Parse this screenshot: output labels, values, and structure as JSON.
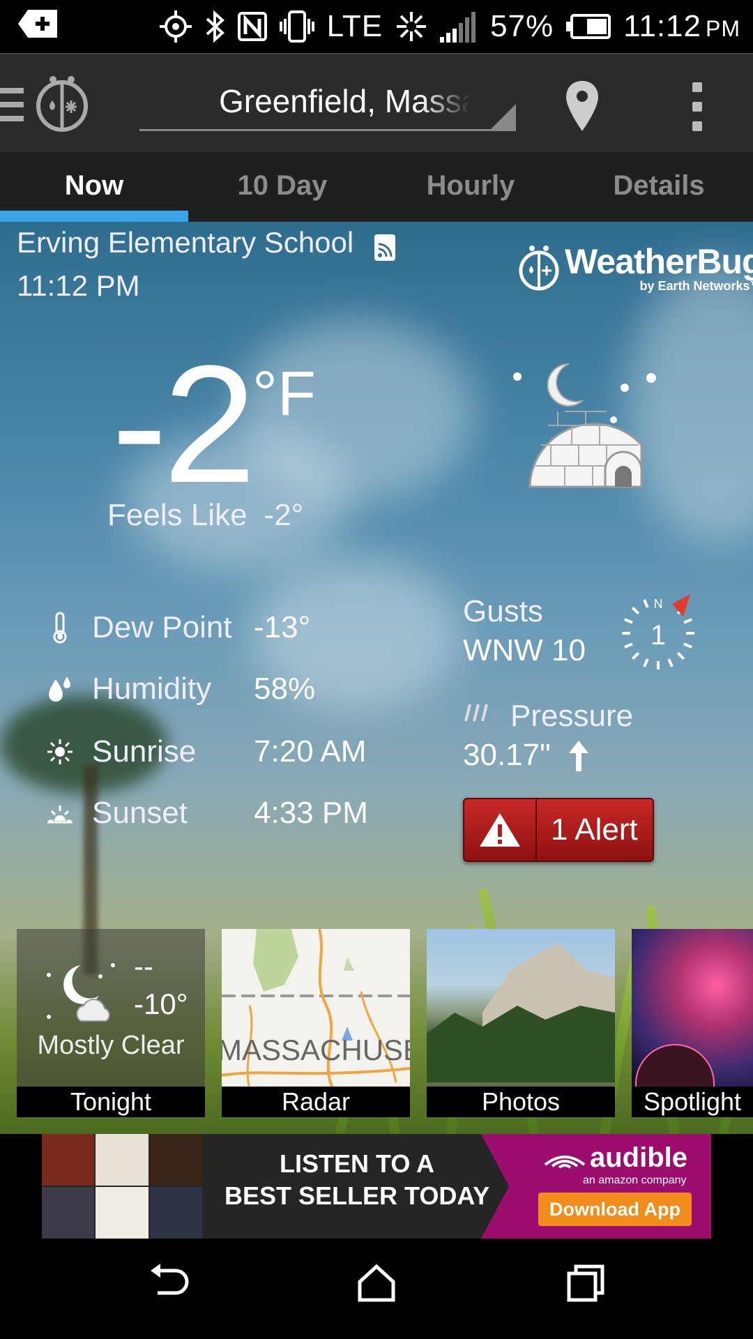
{
  "status_bar": {
    "network": "LTE",
    "battery": "57%",
    "time": "11:12",
    "ampm": "PM"
  },
  "app_bar": {
    "location": "Greenfield, Massachusetts"
  },
  "tabs": [
    {
      "label": "Now",
      "active": true
    },
    {
      "label": "10 Day",
      "active": false
    },
    {
      "label": "Hourly",
      "active": false
    },
    {
      "label": "Details",
      "active": false
    }
  ],
  "current": {
    "station": "Erving Elementary School",
    "time": "11:12 PM",
    "temperature": "-2",
    "unit": "°F",
    "feels_like_label": "Feels Like",
    "feels_like_value": "-2°",
    "condition_icon": "igloo-night-icon"
  },
  "brand": {
    "name": "WeatherBug",
    "sub": "by Earth Networks™"
  },
  "details": [
    {
      "icon": "thermometer-icon",
      "label": "Dew Point",
      "value": "-13°"
    },
    {
      "icon": "humidity-drop-icon",
      "label": "Humidity",
      "value": "58%"
    },
    {
      "icon": "sunrise-icon",
      "label": "Sunrise",
      "value": "7:20 AM"
    },
    {
      "icon": "sunset-icon",
      "label": "Sunset",
      "value": "4:33 PM"
    }
  ],
  "wind": {
    "label": "Gusts",
    "value": "WNW 10",
    "compass_letter": "N",
    "compass_speed": "1"
  },
  "pressure": {
    "label": "Pressure",
    "value": "30.17\"",
    "trend": "rising"
  },
  "alert": {
    "label": "1 Alert"
  },
  "cards": {
    "tonight": {
      "label": "Tonight",
      "high": "--",
      "low": "-10°",
      "desc": "Mostly Clear"
    },
    "radar": {
      "label": "Radar",
      "map_text": "MASSACHUSETTS"
    },
    "photos": {
      "label": "Photos"
    },
    "spotlight": {
      "label": "Spotlight"
    }
  },
  "ad": {
    "headline_1": "LISTEN TO A",
    "headline_2": "BEST SELLER TODAY",
    "brand": "audible",
    "brand_sub": "an amazon company",
    "button": "Download App"
  },
  "colors": {
    "tab_indicator": "#3aa4e8",
    "alert_red": "#c92828",
    "ad_magenta": "#9c0d6e",
    "ad_orange": "#f28c1a"
  }
}
